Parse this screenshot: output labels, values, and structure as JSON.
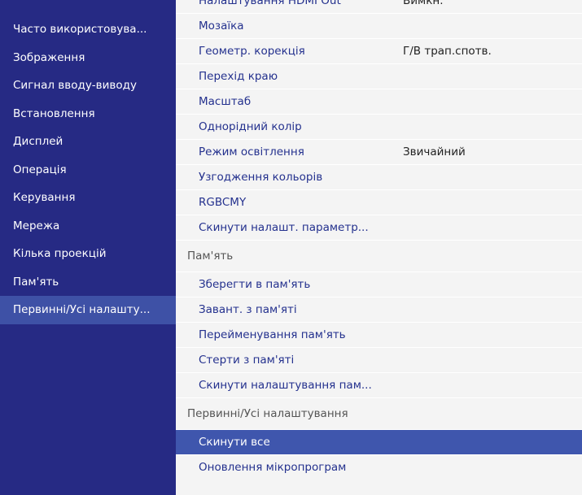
{
  "colors": {
    "sidebar_bg": "#262a84",
    "sidebar_selected_bg": "#3e51a6",
    "panel_bg": "#f4f4f4",
    "item_text": "#24318e",
    "highlight_bg": "#3f56ad"
  },
  "sidebar": {
    "items": [
      {
        "label": "Часто використовува..."
      },
      {
        "label": "Зображення"
      },
      {
        "label": "Сигнал вводу-виводу"
      },
      {
        "label": "Встановлення"
      },
      {
        "label": "Дисплей"
      },
      {
        "label": "Операція"
      },
      {
        "label": "Керування"
      },
      {
        "label": "Мережа"
      },
      {
        "label": "Кілька проекцій"
      },
      {
        "label": "Пам'ять"
      },
      {
        "label": "Первинні/Усі налашту...",
        "selected": true
      }
    ]
  },
  "panel": {
    "rows": [
      {
        "type": "item",
        "label": "Налаштування HDMI Out",
        "value": "Вимкн."
      },
      {
        "type": "item",
        "label": "Мозаїка"
      },
      {
        "type": "item",
        "label": "Геометр. корекція",
        "value": "Г/В трап.спотв."
      },
      {
        "type": "item",
        "label": "Перехід краю"
      },
      {
        "type": "item",
        "label": "Масштаб"
      },
      {
        "type": "item",
        "label": "Однорідний колір"
      },
      {
        "type": "item",
        "label": "Режим освітлення",
        "value": "Звичайний"
      },
      {
        "type": "item",
        "label": "Узгодження кольорів"
      },
      {
        "type": "item",
        "label": "RGBCMY"
      },
      {
        "type": "item",
        "label": "Скинути налашт. параметр..."
      },
      {
        "type": "section",
        "label": "Пам'ять"
      },
      {
        "type": "item",
        "label": "Зберегти в пам'ять"
      },
      {
        "type": "item",
        "label": "Завант. з пам'яті"
      },
      {
        "type": "item",
        "label": "Перейменування пам'ять"
      },
      {
        "type": "item",
        "label": "Стерти з пам'яті"
      },
      {
        "type": "item",
        "label": "Скинути налаштування пам..."
      },
      {
        "type": "section",
        "label": "Первинні/Усі налаштування"
      },
      {
        "type": "item",
        "label": "Скинути все",
        "highlighted": true
      },
      {
        "type": "item",
        "label": "Оновлення мікропрограм"
      }
    ]
  }
}
